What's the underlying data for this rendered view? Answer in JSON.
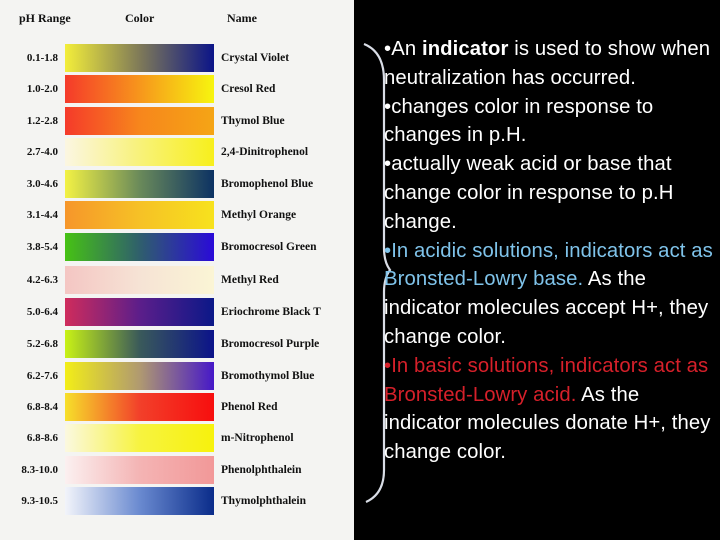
{
  "table": {
    "headers": {
      "range": "pH Range",
      "color": "Color",
      "name": "Name"
    },
    "rows": [
      {
        "range": "0.1-1.8",
        "name": "Crystal Violet",
        "colors": [
          "#f3ee3a",
          "#7f7a58",
          "#0b1488"
        ]
      },
      {
        "range": "1.0-2.0",
        "name": "Cresol Red",
        "colors": [
          "#f53a2a",
          "#f7961c",
          "#f7f50f"
        ]
      },
      {
        "range": "1.2-2.8",
        "name": "Thymol Blue",
        "colors": [
          "#f53a2a",
          "#f7861c",
          "#f5a515"
        ]
      },
      {
        "range": "2.7-4.0",
        "name": "2,4-Dinitrophenol",
        "colors": [
          "#fbf6e2",
          "#f8f27a",
          "#f7ef1c"
        ]
      },
      {
        "range": "3.0-4.6",
        "name": "Bromophenol Blue",
        "colors": [
          "#f3f244",
          "#6a8a5a",
          "#0c3263"
        ]
      },
      {
        "range": "3.1-4.4",
        "name": "Methyl Orange",
        "colors": [
          "#f6962a",
          "#f6c126",
          "#f7e21d"
        ]
      },
      {
        "range": "3.8-5.4",
        "name": "Bromocresol Green",
        "colors": [
          "#46c214",
          "#2f5f6c",
          "#2a0ad8"
        ]
      },
      {
        "range": "4.2-6.3",
        "name": "Methyl Red",
        "colors": [
          "#f4c6c3",
          "#f6e3d5",
          "#fbf5d5"
        ]
      },
      {
        "range": "5.0-6.4",
        "name": "Eriochrome Black T",
        "colors": [
          "#cf2c5c",
          "#5c1e8a",
          "#0b1888"
        ]
      },
      {
        "range": "5.2-6.8",
        "name": "Bromocresol Purple",
        "colors": [
          "#c8f215",
          "#3a5a5a",
          "#0b138a"
        ]
      },
      {
        "range": "6.2-7.6",
        "name": "Bromothymol Blue",
        "colors": [
          "#f3ee17",
          "#b09a70",
          "#4618c8"
        ]
      },
      {
        "range": "6.8-8.4",
        "name": "Phenol Red",
        "colors": [
          "#f7e02a",
          "#f2402a",
          "#f70e0e"
        ]
      },
      {
        "range": "6.8-8.6",
        "name": "m-Nitrophenol",
        "colors": [
          "#fbf8e0",
          "#f7f340",
          "#f7f20c"
        ]
      },
      {
        "range": "8.3-10.0",
        "name": "Phenolphthalein",
        "colors": [
          "#fbf0f0",
          "#f4b4b4",
          "#f29898"
        ]
      },
      {
        "range": "9.3-10.5",
        "name": "Thymolphthalein",
        "colors": [
          "#f2f4fa",
          "#6a8ad0",
          "#0a2c8a"
        ]
      }
    ]
  },
  "notes": {
    "p1_bullet": "•An ",
    "p1_bold": "indicator",
    "p1_rest": " is used to show when neutralization has occurred.",
    "p2": "•changes color in response to changes in p.H.",
    "p3": "•actually weak acid or base that change color in response to p.H change.",
    "p4_highlight": "•In acidic solutions, indicators act as Bronsted-Lowry base.",
    "p4_rest": " As the indicator molecules accept H+, they change color.",
    "p5_highlight": "•In basic solutions, indicators act as Bronsted-Lowry acid.",
    "p5_rest": " As the indicator molecules donate H+, they change color."
  },
  "colors": {
    "acid_highlight": "#7fc3ea",
    "base_highlight": "#d6202a",
    "background": "#000000",
    "chart_background": "#f4f4f2"
  }
}
